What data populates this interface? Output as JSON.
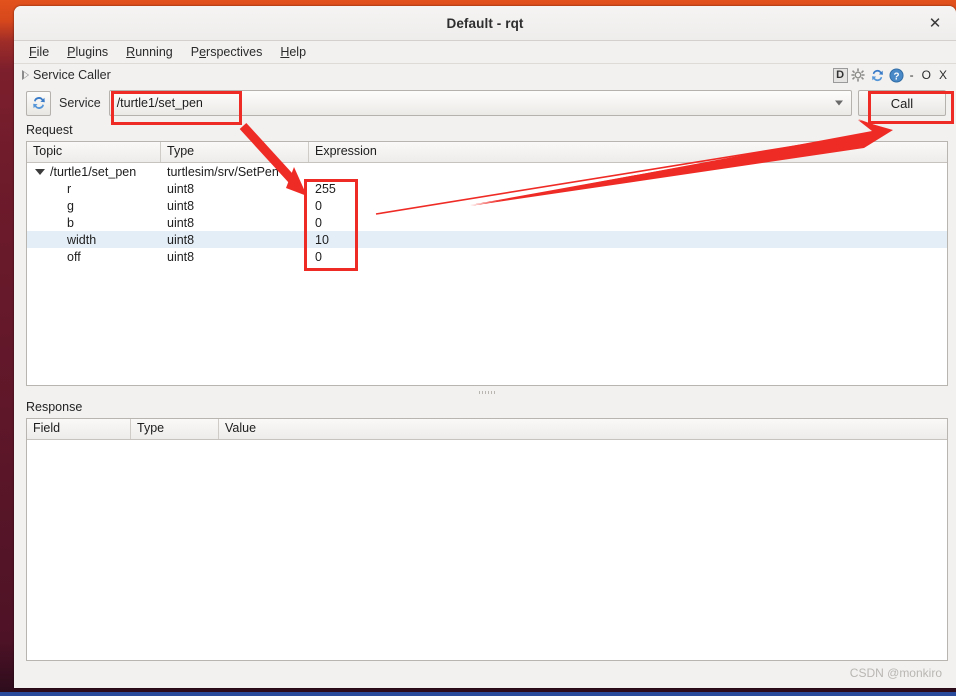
{
  "window": {
    "title": "Default - rqt",
    "close_label": "✕"
  },
  "menubar": {
    "items": [
      {
        "label": "File",
        "mnemonic": "F"
      },
      {
        "label": "Plugins",
        "mnemonic": "P"
      },
      {
        "label": "Running",
        "mnemonic": "R"
      },
      {
        "label": "Perspectives",
        "mnemonic": "e"
      },
      {
        "label": "Help",
        "mnemonic": "H"
      }
    ]
  },
  "dock": {
    "title": "Service Caller",
    "tools": {
      "dock_icon_label": "D",
      "gear_icon": "gear-icon",
      "reload_icon": "reload-icon",
      "help_icon": "help-icon",
      "minimize_label": "-",
      "maximize_label": "O",
      "close_label": "X"
    }
  },
  "service_bar": {
    "refresh_icon": "refresh-icon",
    "label": "Service",
    "value": "/turtle1/set_pen",
    "placeholder": "/turtle1/set_pen",
    "call_label": "Call"
  },
  "request": {
    "section_label": "Request",
    "columns": [
      "Topic",
      "Type",
      "Expression"
    ],
    "rows": [
      {
        "topic": "/turtle1/set_pen",
        "type": "turtlesim/srv/SetPen",
        "expression": "",
        "root": true,
        "selected": false
      },
      {
        "topic": "r",
        "type": "uint8",
        "expression": "255",
        "root": false,
        "selected": false
      },
      {
        "topic": "g",
        "type": "uint8",
        "expression": "0",
        "root": false,
        "selected": false
      },
      {
        "topic": "b",
        "type": "uint8",
        "expression": "0",
        "root": false,
        "selected": false
      },
      {
        "topic": "width",
        "type": "uint8",
        "expression": "10",
        "root": false,
        "selected": true
      },
      {
        "topic": "off",
        "type": "uint8",
        "expression": "0",
        "root": false,
        "selected": false
      }
    ]
  },
  "response": {
    "section_label": "Response",
    "columns": [
      "Field",
      "Type",
      "Value"
    ],
    "rows": []
  },
  "annotations": {
    "highlight_color": "#ef2b26",
    "boxes": [
      "service-value-box",
      "expression-column-box",
      "call-button-box"
    ],
    "arrows": [
      "service-to-expression-arrow",
      "expression-to-call-arrow"
    ]
  },
  "watermark": {
    "text": "CSDN @monkiro"
  }
}
